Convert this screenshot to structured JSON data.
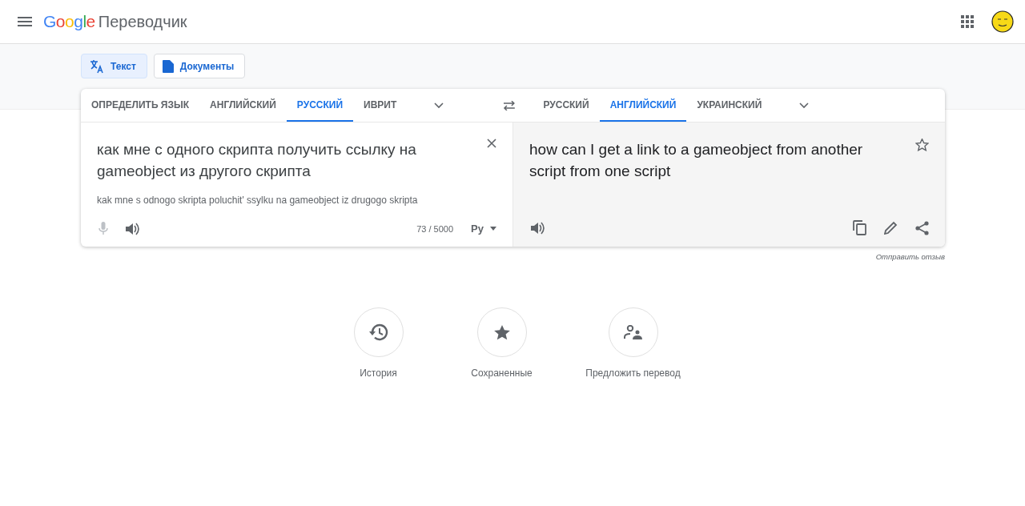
{
  "header": {
    "logo": "Google",
    "product": "Переводчик"
  },
  "modes": [
    {
      "label": "Текст",
      "kind": "text",
      "selected": true
    },
    {
      "label": "Документы",
      "kind": "docs",
      "selected": false
    }
  ],
  "source_tabs": [
    {
      "label": "ОПРЕДЕЛИТЬ ЯЗЫК",
      "selected": false
    },
    {
      "label": "АНГЛИЙСКИЙ",
      "selected": false
    },
    {
      "label": "РУССКИЙ",
      "selected": true
    },
    {
      "label": "ИВРИТ",
      "selected": false
    }
  ],
  "target_tabs": [
    {
      "label": "РУССКИЙ",
      "selected": false
    },
    {
      "label": "АНГЛИЙСКИЙ",
      "selected": true
    },
    {
      "label": "УКРАИНСКИЙ",
      "selected": false
    }
  ],
  "source": {
    "text": "как мне с одного скрипта получить ссылку на gameobject из другого скрипта",
    "transliteration": "kak mne s odnogo skripta poluchit' ssylku na gameobject iz drugogo skripta",
    "char_count": "73 / 5000",
    "keyboard": "Ру"
  },
  "target": {
    "text": "how can I get a link to a gameobject from another script from one script"
  },
  "feedback": "Отправить отзыв",
  "shortcuts": [
    {
      "label": "История",
      "kind": "history"
    },
    {
      "label": "Сохраненные",
      "kind": "saved"
    },
    {
      "label": "Предложить перевод",
      "kind": "contribute"
    }
  ]
}
